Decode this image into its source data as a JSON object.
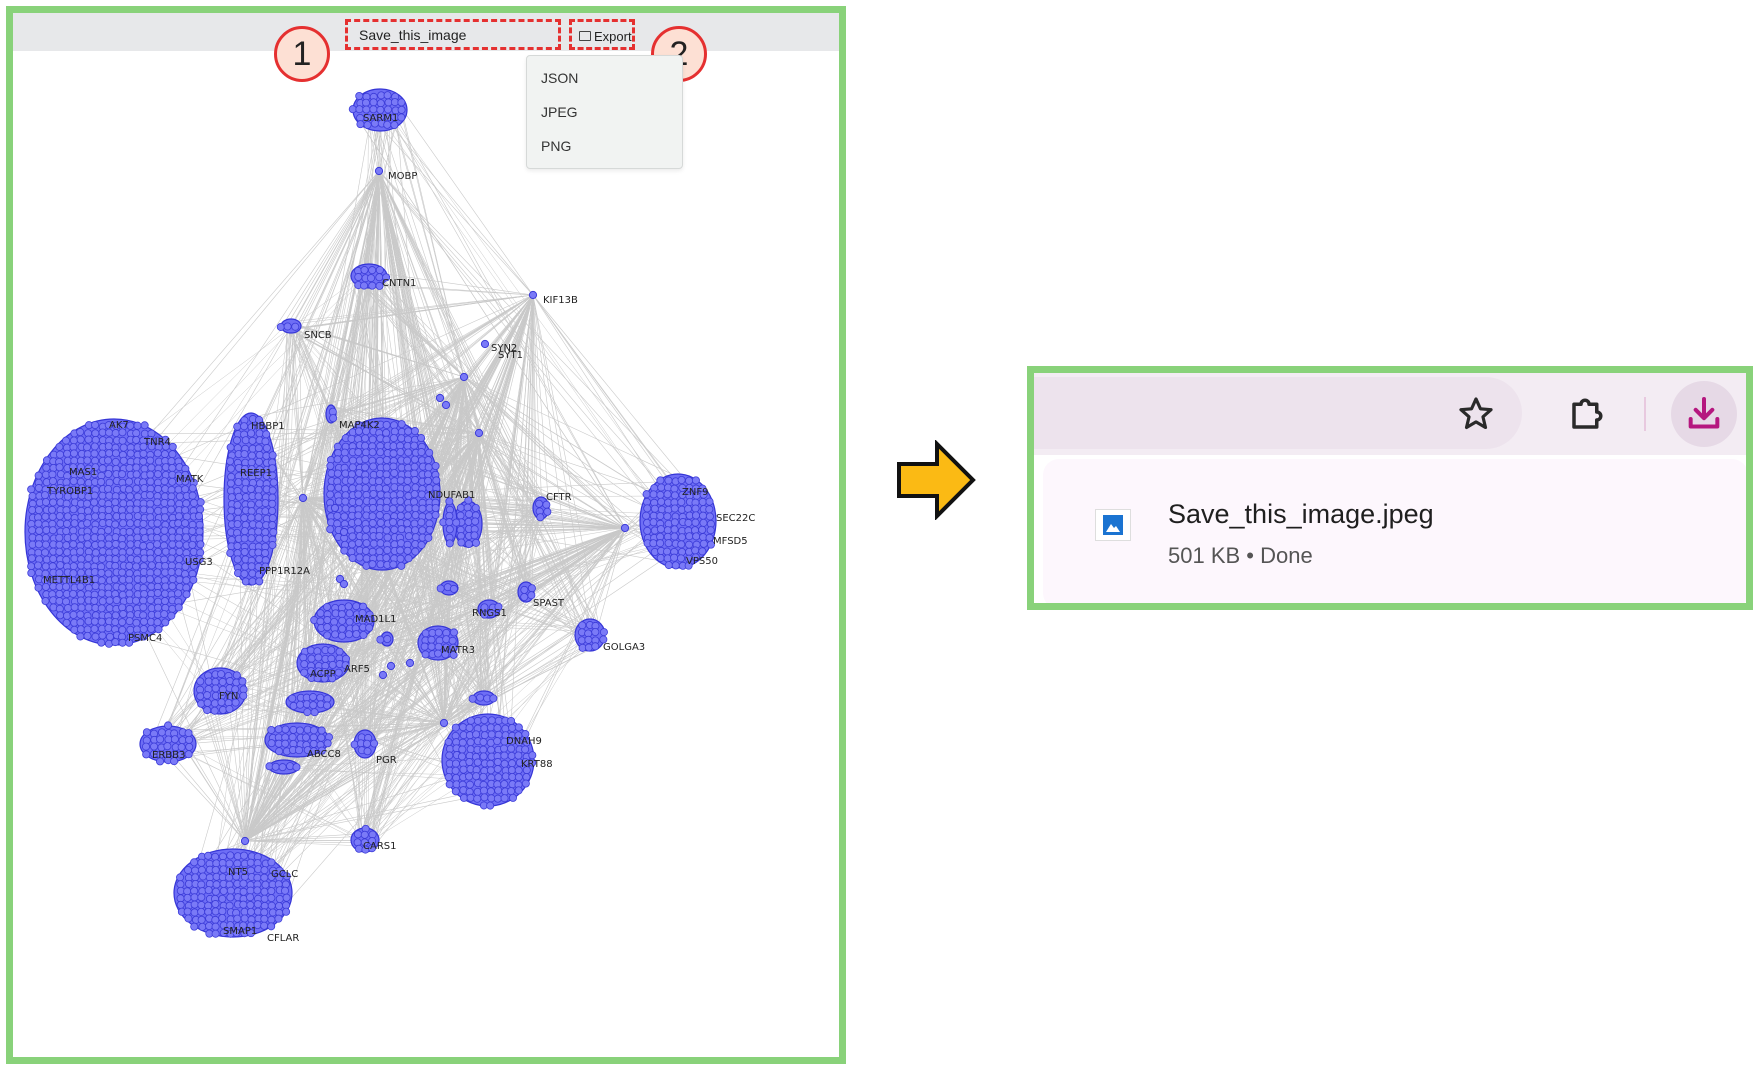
{
  "export_panel": {
    "filename_value": "Save_this_image",
    "export_label": "Export",
    "menu_items": [
      "JSON",
      "JPEG",
      "PNG"
    ],
    "step_labels": [
      "1",
      "2"
    ]
  },
  "network": {
    "labels": [
      "SARM1",
      "MOBP",
      "CNTN1",
      "KIF13B",
      "SNCB",
      "SYN2",
      "SYT1",
      "AK7",
      "TNR4",
      "MAS1",
      "TYROBP1",
      "MATK",
      "USG3",
      "METTL4B1",
      "PSMC4",
      "HBBP1",
      "REEP1",
      "PPP1R12A",
      "MAP4K2",
      "NDUFAB1",
      "CFTR",
      "ZNF9",
      "SEC22C",
      "MFSD5",
      "VPS50",
      "SPAST",
      "RNGS1",
      "MAD1L1",
      "MATR3",
      "GOLGA3",
      "ARF5",
      "ACPP",
      "FYN",
      "ERBB3",
      "ABCC8",
      "PGR",
      "DNAH9",
      "KRT88",
      "CARS1",
      "GCLC",
      "CFLAR",
      "SMAP1",
      "NT5"
    ]
  },
  "browser": {
    "download_item": {
      "filename": "Save_this_image.jpeg",
      "status": "501 KB • Done"
    },
    "icons": [
      "star-icon",
      "extensions-icon",
      "download-icon",
      "image-file-icon"
    ]
  },
  "colors": {
    "frame_green": "#89d27a",
    "highlight_red": "#e53030",
    "node_fill": "#6e6ef5",
    "node_stroke": "#3535d6",
    "edge": "#c9c9c9",
    "arrow_fill": "#fbba14",
    "download_accent": "#b5177f"
  }
}
